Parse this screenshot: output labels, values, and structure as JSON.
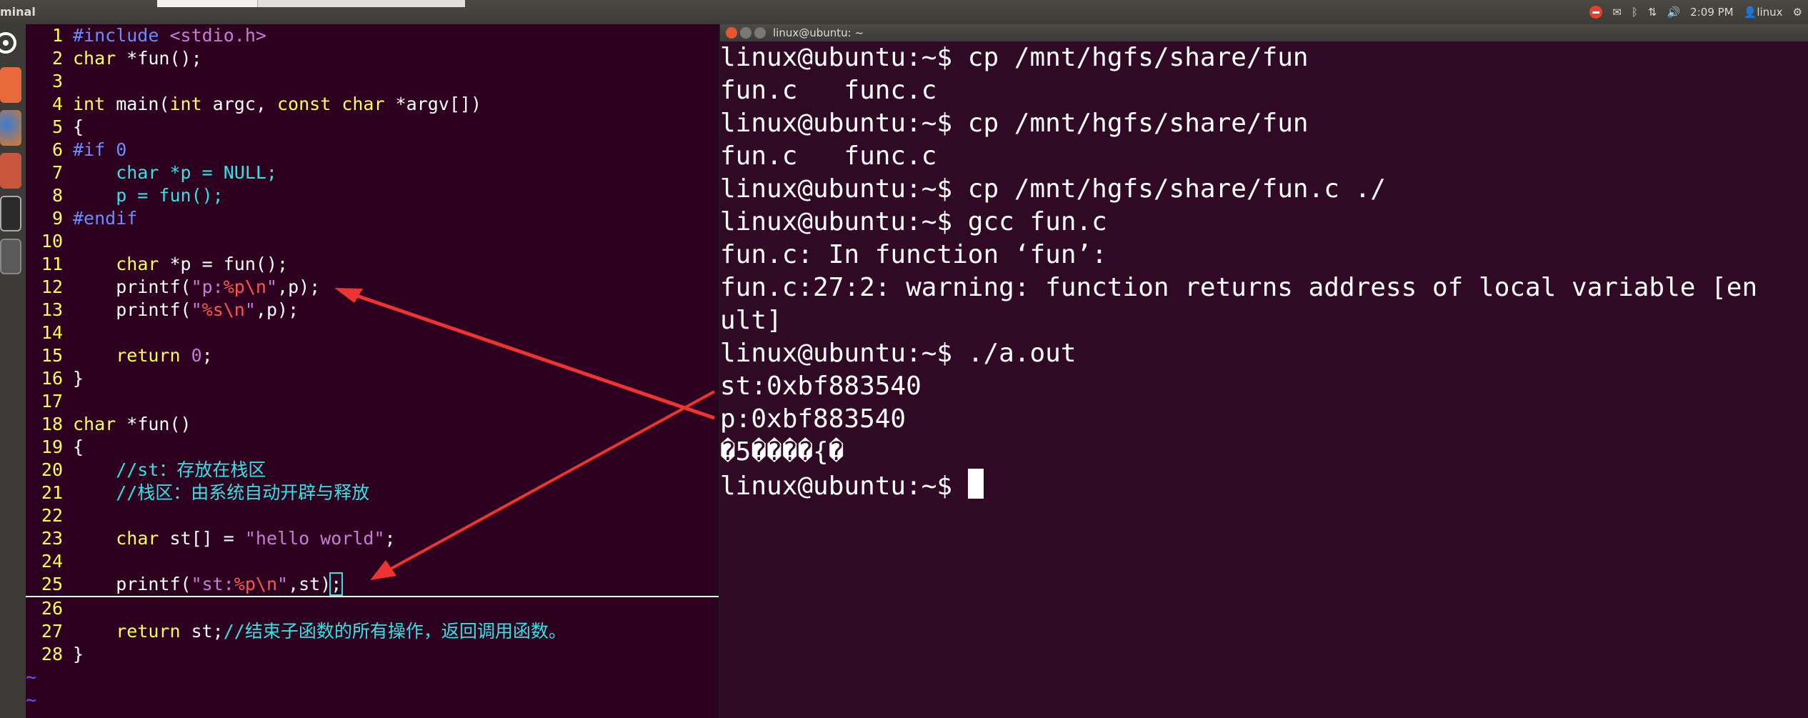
{
  "panel": {
    "app_name": "minal",
    "time": "2:09 PM",
    "user": "linux",
    "icons": [
      "error-indicator-icon",
      "mail-icon",
      "bluetooth-icon",
      "network-icon",
      "volume-icon",
      "user-icon",
      "gear-icon"
    ]
  },
  "launcher": {
    "icons": [
      "ubuntu-logo-icon",
      "files-icon",
      "firefox-icon",
      "settings-icon",
      "terminal-icon",
      "workspace-icon"
    ]
  },
  "vim": {
    "lines": [
      {
        "n": "1",
        "segs": [
          {
            "t": "#include ",
            "c": "pp"
          },
          {
            "t": "<stdio.h>",
            "c": "str"
          }
        ]
      },
      {
        "n": "2",
        "segs": [
          {
            "t": "char",
            "c": "kw"
          },
          {
            "t": " *fun();",
            "c": ""
          }
        ]
      },
      {
        "n": "3",
        "segs": []
      },
      {
        "n": "4",
        "segs": [
          {
            "t": "int",
            "c": "kw"
          },
          {
            "t": " main(",
            "c": ""
          },
          {
            "t": "int",
            "c": "kw"
          },
          {
            "t": " argc, ",
            "c": ""
          },
          {
            "t": "const",
            "c": "kw"
          },
          {
            "t": " ",
            "c": ""
          },
          {
            "t": "char",
            "c": "kw"
          },
          {
            "t": " *argv[])",
            "c": ""
          }
        ]
      },
      {
        "n": "5",
        "segs": [
          {
            "t": "{",
            "c": ""
          }
        ]
      },
      {
        "n": "6",
        "segs": [
          {
            "t": "#if 0",
            "c": "pp"
          }
        ]
      },
      {
        "n": "7",
        "segs": [
          {
            "t": "    char *p = NULL;",
            "c": "id"
          }
        ]
      },
      {
        "n": "8",
        "segs": [
          {
            "t": "    p = fun();",
            "c": "id"
          }
        ]
      },
      {
        "n": "9",
        "segs": [
          {
            "t": "#endif",
            "c": "pp"
          }
        ]
      },
      {
        "n": "10",
        "segs": []
      },
      {
        "n": "11",
        "segs": [
          {
            "t": "    ",
            "c": ""
          },
          {
            "t": "char",
            "c": "kw"
          },
          {
            "t": " *p = fun();",
            "c": ""
          }
        ]
      },
      {
        "n": "12",
        "segs": [
          {
            "t": "    printf(",
            "c": ""
          },
          {
            "t": "\"p:",
            "c": "str"
          },
          {
            "t": "%p\\n",
            "c": "esc"
          },
          {
            "t": "\"",
            "c": "str"
          },
          {
            "t": ",p);",
            "c": ""
          }
        ]
      },
      {
        "n": "13",
        "segs": [
          {
            "t": "    printf(",
            "c": ""
          },
          {
            "t": "\"",
            "c": "str"
          },
          {
            "t": "%s\\n",
            "c": "esc"
          },
          {
            "t": "\"",
            "c": "str"
          },
          {
            "t": ",p);",
            "c": ""
          }
        ]
      },
      {
        "n": "14",
        "segs": []
      },
      {
        "n": "15",
        "segs": [
          {
            "t": "    ",
            "c": ""
          },
          {
            "t": "return",
            "c": "kw"
          },
          {
            "t": " ",
            "c": ""
          },
          {
            "t": "0",
            "c": "num"
          },
          {
            "t": ";",
            "c": ""
          }
        ]
      },
      {
        "n": "16",
        "segs": [
          {
            "t": "}",
            "c": ""
          }
        ]
      },
      {
        "n": "17",
        "segs": []
      },
      {
        "n": "18",
        "segs": [
          {
            "t": "char",
            "c": "kw"
          },
          {
            "t": " *fun()",
            "c": ""
          }
        ]
      },
      {
        "n": "19",
        "segs": [
          {
            "t": "{",
            "c": ""
          }
        ]
      },
      {
        "n": "20",
        "segs": [
          {
            "t": "    //st：存放在栈区",
            "c": "cm"
          }
        ]
      },
      {
        "n": "21",
        "segs": [
          {
            "t": "    //栈区：由系统自动开辟与释放",
            "c": "cm"
          }
        ]
      },
      {
        "n": "22",
        "segs": []
      },
      {
        "n": "23",
        "segs": [
          {
            "t": "    ",
            "c": ""
          },
          {
            "t": "char",
            "c": "kw"
          },
          {
            "t": " st[] = ",
            "c": ""
          },
          {
            "t": "\"hello world\"",
            "c": "str"
          },
          {
            "t": ";",
            "c": ""
          }
        ]
      },
      {
        "n": "24",
        "segs": []
      },
      {
        "n": "25",
        "segs": [
          {
            "t": "    printf(",
            "c": ""
          },
          {
            "t": "\"st:",
            "c": "str"
          },
          {
            "t": "%p\\n",
            "c": "esc"
          },
          {
            "t": "\"",
            "c": "str"
          },
          {
            "t": ",st)",
            "c": ""
          },
          {
            "t": ";",
            "c": "cur"
          }
        ],
        "cursorline": true
      },
      {
        "n": "26",
        "segs": []
      },
      {
        "n": "27",
        "segs": [
          {
            "t": "    ",
            "c": ""
          },
          {
            "t": "return",
            "c": "kw"
          },
          {
            "t": " st;",
            "c": ""
          },
          {
            "t": "//结束子函数的所有操作，返回调用函数。",
            "c": "cm"
          }
        ]
      },
      {
        "n": "28",
        "segs": [
          {
            "t": "}",
            "c": ""
          }
        ]
      },
      {
        "n": "~",
        "segs": [],
        "tilde": true
      },
      {
        "n": "~",
        "segs": [],
        "tilde": true
      }
    ]
  },
  "terminal": {
    "title": "linux@ubuntu: ~",
    "lines": [
      "linux@ubuntu:~$ cp /mnt/hgfs/share/fun",
      "fun.c   func.c",
      "linux@ubuntu:~$ cp /mnt/hgfs/share/fun",
      "fun.c   func.c",
      "linux@ubuntu:~$ cp /mnt/hgfs/share/fun.c ./",
      "linux@ubuntu:~$ gcc fun.c",
      "fun.c: In function ‘fun’:",
      "fun.c:27:2: warning: function returns address of local variable [en",
      "ult]",
      "linux@ubuntu:~$ ./a.out",
      "st:0xbf883540",
      "p:0xbf883540",
      "�5����{�",
      "linux@ubuntu:~$ "
    ]
  }
}
